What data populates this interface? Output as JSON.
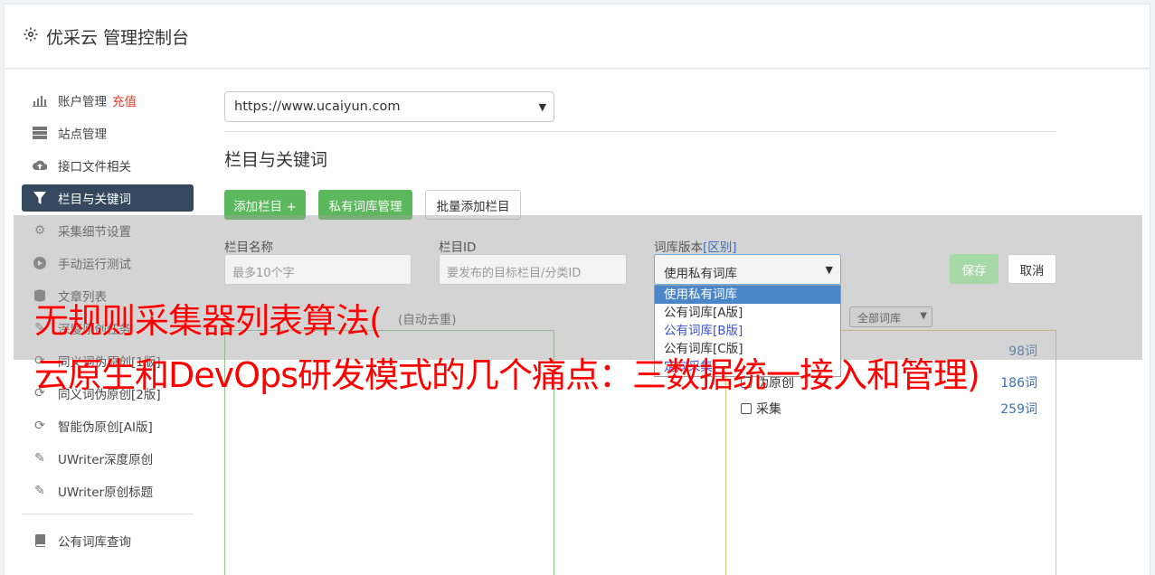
{
  "header": {
    "title": "优采云 管理控制台",
    "icon": "gear-icon"
  },
  "sidebar": {
    "items": [
      {
        "label": "账户管理",
        "badge": "充值",
        "icon": "bar-chart-icon"
      },
      {
        "label": "站点管理",
        "icon": "server-icon"
      },
      {
        "label": "接口文件相关",
        "icon": "cloud-upload-icon"
      },
      {
        "label": "栏目与关键词",
        "icon": "filter-icon",
        "active": true
      },
      {
        "label": "采集细节设置",
        "icon": "cogs-icon"
      },
      {
        "label": "手动运行测试",
        "icon": "play-circle-icon"
      },
      {
        "label": "文章列表",
        "icon": "database-icon"
      },
      {
        "label": "深度原创任务",
        "icon": "edit-icon"
      },
      {
        "label": "同义词伪原创[1版]",
        "icon": "refresh-icon"
      },
      {
        "label": "同义词伪原创[2版]",
        "icon": "refresh-icon"
      },
      {
        "label": "智能伪原创[AI版]",
        "icon": "refresh-icon"
      },
      {
        "label": "UWriter深度原创",
        "icon": "edit-icon"
      },
      {
        "label": "UWriter原创标题",
        "icon": "edit-icon"
      },
      {
        "label": "公有词库查询",
        "icon": "book-icon"
      }
    ]
  },
  "main": {
    "site_select": "https://www.ucaiyun.com",
    "section_title": "栏目与关键词",
    "buttons": {
      "add_column": "添加栏目 +",
      "private_lib": "私有词库管理",
      "batch_add": "批量添加栏目",
      "save": "保存",
      "cancel": "取消"
    },
    "form": {
      "name_label": "栏目名称",
      "name_placeholder": "最多10个字",
      "id_label": "栏目ID",
      "id_placeholder": "要发布的目标栏目/分类ID",
      "version_label": "词库版本",
      "version_link": "[区别]",
      "version_selected": "使用私有词库"
    },
    "dropdown_options": [
      "使用私有词库",
      "公有词库[A版]",
      "公有词库[B版]",
      "公有词库[C版]",
      "定向采集"
    ],
    "keyword_label_fragment": "(自动去重)",
    "lib_filter": "全部词库",
    "lib_rows": [
      {
        "name": "",
        "count": "98词"
      },
      {
        "name": "伪原创",
        "count": "186词"
      },
      {
        "name": "采集",
        "count": "259词"
      }
    ]
  },
  "watermark": {
    "line1": "无规则采集器列表算法(",
    "line2": "云原生和DevOps研发模式的几个痛点：三数据统一接入和管理)"
  },
  "colors": {
    "accent_green": "#5cb85c",
    "active_nav": "#34495e",
    "watermark": "#ff0000",
    "link": "#3b6fb6"
  }
}
